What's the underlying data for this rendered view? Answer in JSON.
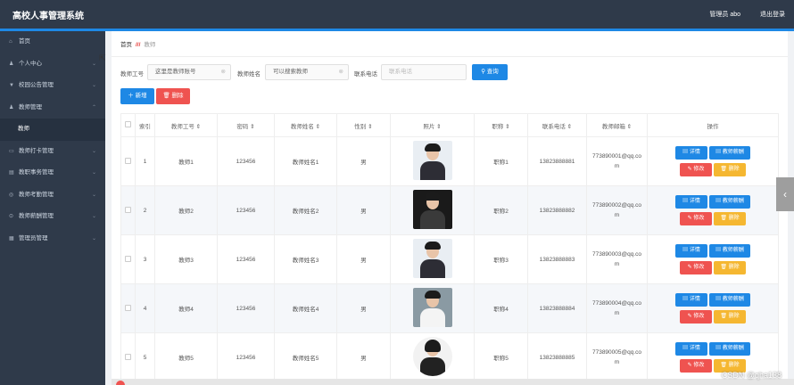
{
  "header": {
    "title": "高校人事管理系统",
    "admin": "管理员 abo",
    "logout": "退出登录"
  },
  "sidebar": {
    "items": [
      {
        "label": "首页",
        "icon": "home-icon"
      },
      {
        "label": "个人中心",
        "icon": "user-icon"
      },
      {
        "label": "校园公告管理",
        "icon": "notice-icon"
      },
      {
        "label": "教师管理",
        "icon": "teacher-icon"
      },
      {
        "label": "教师",
        "sub": true
      },
      {
        "label": "教师打卡管理",
        "icon": "checkin-icon"
      },
      {
        "label": "教职事务管理",
        "icon": "affairs-icon"
      },
      {
        "label": "教师考勤管理",
        "icon": "attendance-icon"
      },
      {
        "label": "教师薪酬管理",
        "icon": "salary-icon"
      },
      {
        "label": "管理员管理",
        "icon": "admin-icon"
      }
    ]
  },
  "breadcrumb": {
    "home": "首页",
    "sep": "///",
    "current": "教师"
  },
  "filters": {
    "gonghao_label": "教师工号",
    "gonghao_value": "这里是教师账号",
    "name_label": "教师姓名",
    "name_value": "可以搜索教师",
    "phone_label": "联系电话",
    "phone_placeholder": "联系电话",
    "search": "查询"
  },
  "actions": {
    "add": "新增",
    "delete": "删除"
  },
  "table": {
    "headers": [
      "索引",
      "教师工号",
      "密码",
      "教师姓名",
      "性别",
      "照片",
      "职称",
      "联系电话",
      "教师邮箱",
      "操作"
    ],
    "rows": [
      {
        "idx": "1",
        "gh": "教师1",
        "pwd": "123456",
        "name": "教师姓名1",
        "sex": "男",
        "title": "职称1",
        "phone": "13823888881",
        "email": "773890001@qq.com"
      },
      {
        "idx": "2",
        "gh": "教师2",
        "pwd": "123456",
        "name": "教师姓名2",
        "sex": "男",
        "title": "职称2",
        "phone": "13823888882",
        "email": "773890002@qq.com"
      },
      {
        "idx": "3",
        "gh": "教师3",
        "pwd": "123456",
        "name": "教师姓名3",
        "sex": "男",
        "title": "职称3",
        "phone": "13823888883",
        "email": "773890003@qq.com"
      },
      {
        "idx": "4",
        "gh": "教师4",
        "pwd": "123456",
        "name": "教师姓名4",
        "sex": "男",
        "title": "职称4",
        "phone": "13823888884",
        "email": "773890004@qq.com"
      },
      {
        "idx": "5",
        "gh": "教师5",
        "pwd": "123456",
        "name": "教师姓名5",
        "sex": "男",
        "title": "职称5",
        "phone": "13823888885",
        "email": "773890005@qq.com"
      }
    ],
    "ops": {
      "detail": "详情",
      "salary": "教师薪酬",
      "edit": "修改",
      "remove": "删除"
    }
  },
  "watermark": "CSDN @qha138",
  "colors": {
    "topbar": "#2f3a4a",
    "accent": "#1e88e5",
    "danger": "#ef5350",
    "warn": "#f5b731"
  }
}
